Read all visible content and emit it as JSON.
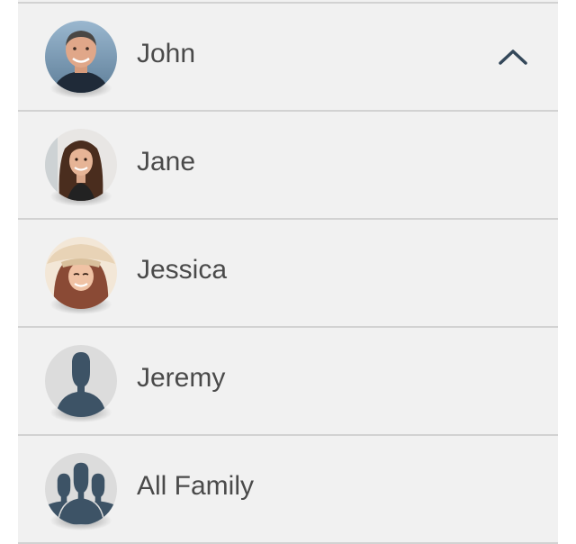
{
  "family_list": {
    "expanded": true,
    "members": [
      {
        "name": "John",
        "avatar": "photo-man"
      },
      {
        "name": "Jane",
        "avatar": "photo-woman"
      },
      {
        "name": "Jessica",
        "avatar": "photo-girl-hat"
      },
      {
        "name": "Jeremy",
        "avatar": "person-silhouette-icon"
      },
      {
        "name": "All Family",
        "avatar": "group-silhouette-icon"
      }
    ],
    "toggle_icon": "chevron-up-icon"
  },
  "colors": {
    "row_background": "#f1f1f1",
    "divider": "#d2d2d2",
    "text": "#4a4a4a",
    "silhouette": "#3d5366",
    "silhouette_bg": "#dcdcdc"
  }
}
